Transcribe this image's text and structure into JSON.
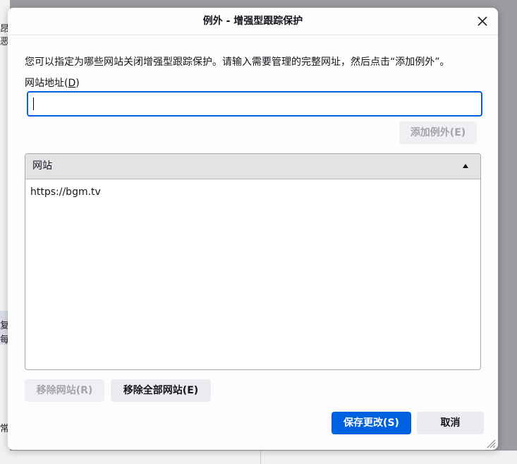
{
  "dialog": {
    "title": "例外 - 增强型跟踪保护",
    "description": "您可以指定为哪些网站关闭增强型跟踪保护。请输入需要管理的完整网址，然后点击“添加例外”。",
    "field_label": "网站地址(",
    "field_label_accesskey": "D",
    "field_label_end": ")",
    "url_value": "",
    "add_button": "添加例外(E)",
    "column_header": "网站",
    "sites": [
      "https://bgm.tv"
    ],
    "remove_button": "移除网站(R)",
    "remove_all_button": "移除全部网站(E)",
    "save_button": "保存更改(S)",
    "cancel_button": "取消"
  },
  "background": {
    "left_glyphs": [
      "昂纟",
      "恶",
      "复 -",
      "每",
      "常"
    ]
  },
  "colors": {
    "accent": "#0061e0",
    "dialog_bg": "#fdfdfe",
    "header_bg": "#e3e3e6",
    "disabled_text": "#a3a3a8"
  }
}
